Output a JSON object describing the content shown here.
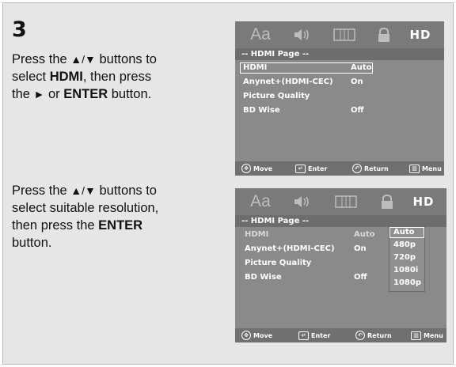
{
  "step_number": "3",
  "instruction1": {
    "line1_pre": "Press the ",
    "line1_arrows": "▲/▼",
    "line1_post": " buttons to",
    "line2_pre": "select ",
    "line2_bold": "HDMI",
    "line2_post": ", then press",
    "line3_pre": "the ",
    "line3_arrow": "►",
    "line3_mid": " or ",
    "line3_bold": "ENTER",
    "line3_post": " button."
  },
  "instruction2": {
    "line1_pre": "Press the ",
    "line1_arrows": "▲/▼",
    "line1_post": " buttons to",
    "line2": "select suitable resolution,",
    "line3_pre": "then press the ",
    "line3_bold": "ENTER",
    "line4": "button."
  },
  "osd": {
    "icons": {
      "text_icon": "Aa",
      "speaker_icon": "speaker-icon",
      "display_icon": "display-icon",
      "lock_icon": "lock-icon",
      "hd_label": "HD"
    },
    "page_title": "-- HDMI Page --",
    "rows": [
      {
        "label": "HDMI",
        "value": "Auto"
      },
      {
        "label": "Anynet+(HDMI-CEC)",
        "value": "On"
      },
      {
        "label": "Picture Quality",
        "value": ""
      },
      {
        "label": "BD Wise",
        "value": "Off"
      }
    ],
    "resolution_options": [
      "Auto",
      "480p",
      "720p",
      "1080i",
      "1080p"
    ],
    "footer": {
      "move": "Move",
      "enter": "Enter",
      "return": "Return",
      "menu": "Menu"
    }
  },
  "colors": {
    "panel_bg": "#e6e6e6",
    "osd_bg": "#8a8a8a",
    "osd_iconbar": "#7a7a7a",
    "osd_text": "#ffffff"
  }
}
